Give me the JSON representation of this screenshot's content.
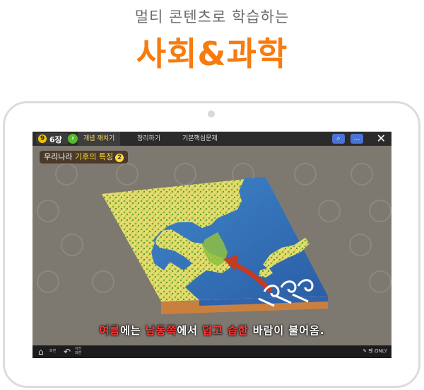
{
  "header": {
    "subtitle": "멀티 콘텐츠로 학습하는",
    "title": "사회&과학"
  },
  "app": {
    "chapter": "6장",
    "chapter_icon": "9",
    "tabs": [
      {
        "label": "개념 깨치기",
        "active": true
      },
      {
        "label": "정리하기",
        "active": false
      },
      {
        "label": "기본핵심문제",
        "active": false
      }
    ],
    "topic": {
      "prefix": "우리나라",
      "highlight": "기후의 특징",
      "number": "2"
    },
    "caption": {
      "parts": [
        {
          "text": "여름",
          "red": true
        },
        {
          "text": "에는 ",
          "red": false
        },
        {
          "text": "남동쪽",
          "red": true
        },
        {
          "text": "에서 ",
          "red": false
        },
        {
          "text": "덥고 습한",
          "red": true
        },
        {
          "text": " 바람이 불어옴.",
          "red": false
        }
      ]
    },
    "bottom": {
      "home_label": "화면",
      "back_label_1": "이전",
      "back_label_2": "화면",
      "pen_label": "펜 ONLY"
    },
    "icons": {
      "close": "close-icon",
      "search": "search-icon",
      "chat": "chat-icon",
      "home": "home-icon",
      "back": "back-icon",
      "pen": "pen-icon"
    },
    "colors": {
      "accent": "#f77b0f",
      "tab_active": "#ffe25a",
      "red_text": "#ff3b3b"
    }
  }
}
